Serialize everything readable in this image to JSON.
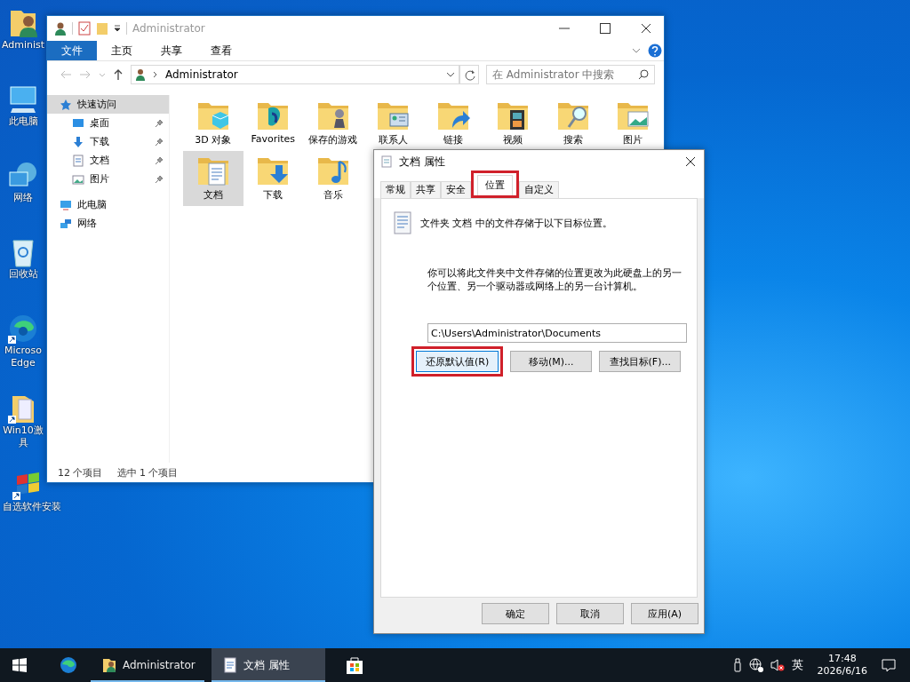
{
  "desktop_icons": [
    {
      "kind": "user",
      "lines": [
        "Administ"
      ]
    },
    {
      "kind": "computer",
      "lines": [
        "此电脑"
      ]
    },
    {
      "kind": "network",
      "lines": [
        "网络"
      ]
    },
    {
      "kind": "recycle",
      "lines": [
        "回收站"
      ]
    },
    {
      "kind": "edge",
      "lines": [
        "Microso",
        "Edge"
      ]
    },
    {
      "kind": "docs",
      "lines": [
        "Win10激",
        "具"
      ]
    },
    {
      "kind": "tiles",
      "lines": [
        "自选软件安装"
      ]
    }
  ],
  "explorer": {
    "title": "Administrator",
    "ribbon_tabs": [
      {
        "label": "文件",
        "selected": true
      },
      {
        "label": "主页",
        "selected": false
      },
      {
        "label": "共享",
        "selected": false
      },
      {
        "label": "查看",
        "selected": false
      }
    ],
    "address": {
      "path": "Administrator"
    },
    "search": {
      "placeholder": "在 Administrator 中搜索"
    },
    "nav": [
      {
        "kind": "star",
        "label": "快速访问",
        "selected": true,
        "children": [
          {
            "kind": "desktop",
            "label": "桌面",
            "pinned": true
          },
          {
            "kind": "download",
            "label": "下载",
            "pinned": true
          },
          {
            "kind": "document",
            "label": "文档",
            "pinned": true
          },
          {
            "kind": "picture",
            "label": "图片",
            "pinned": true
          }
        ]
      },
      {
        "kind": "computer",
        "label": "此电脑",
        "selected": false
      },
      {
        "kind": "network",
        "label": "网络",
        "selected": false
      }
    ],
    "items": [
      {
        "kind": "cube",
        "label": "3D 对象",
        "selected": false
      },
      {
        "kind": "favorites",
        "label": "Favorites",
        "selected": false
      },
      {
        "kind": "chess",
        "label": "保存的游戏",
        "selected": false
      },
      {
        "kind": "contact",
        "label": "联系人",
        "selected": false
      },
      {
        "kind": "link",
        "label": "链接",
        "selected": false
      },
      {
        "kind": "film",
        "label": "视频",
        "selected": false
      },
      {
        "kind": "magnifier",
        "label": "搜索",
        "selected": false
      },
      {
        "kind": "photo",
        "label": "图片",
        "selected": false
      },
      {
        "kind": "document",
        "label": "文档",
        "selected": true
      },
      {
        "kind": "download",
        "label": "下载",
        "selected": false
      },
      {
        "kind": "music",
        "label": "音乐",
        "selected": false
      }
    ],
    "status": [
      "12 个项目",
      "选中 1 个项目"
    ]
  },
  "dialog": {
    "title": "文档 属性",
    "tabs": [
      {
        "label": "常规",
        "selected": false,
        "highlight": false
      },
      {
        "label": "共享",
        "selected": false,
        "highlight": false
      },
      {
        "label": "安全",
        "selected": false,
        "highlight": false
      },
      {
        "label": "位置",
        "selected": true,
        "highlight": true
      },
      {
        "label": "自定义",
        "selected": false,
        "highlight": false
      }
    ],
    "intro": "文件夹 文档 中的文件存储于以下目标位置。",
    "explanation": "你可以将此文件夹中文件存储的位置更改为此硬盘上的另一个位置、另一个驱动器或网络上的另一台计算机。",
    "path": "C:\\Users\\Administrator\\Documents",
    "buttons": [
      {
        "label": "还原默认值(R)",
        "highlight": true
      },
      {
        "label": "移动(M)...",
        "highlight": false
      },
      {
        "label": "查找目标(F)...",
        "highlight": false
      }
    ],
    "footer_buttons": [
      "确定",
      "取消",
      "应用(A)"
    ]
  },
  "taskbar": {
    "apps": [
      {
        "kind": "edge",
        "active": false
      },
      {
        "kind": "user",
        "label": "Administrator",
        "active": false
      },
      {
        "kind": "document",
        "label": "文档 属性",
        "active": true
      },
      {
        "kind": "store",
        "active": false
      }
    ],
    "language": "英",
    "time": "17:48",
    "date": "2026/6/16"
  }
}
